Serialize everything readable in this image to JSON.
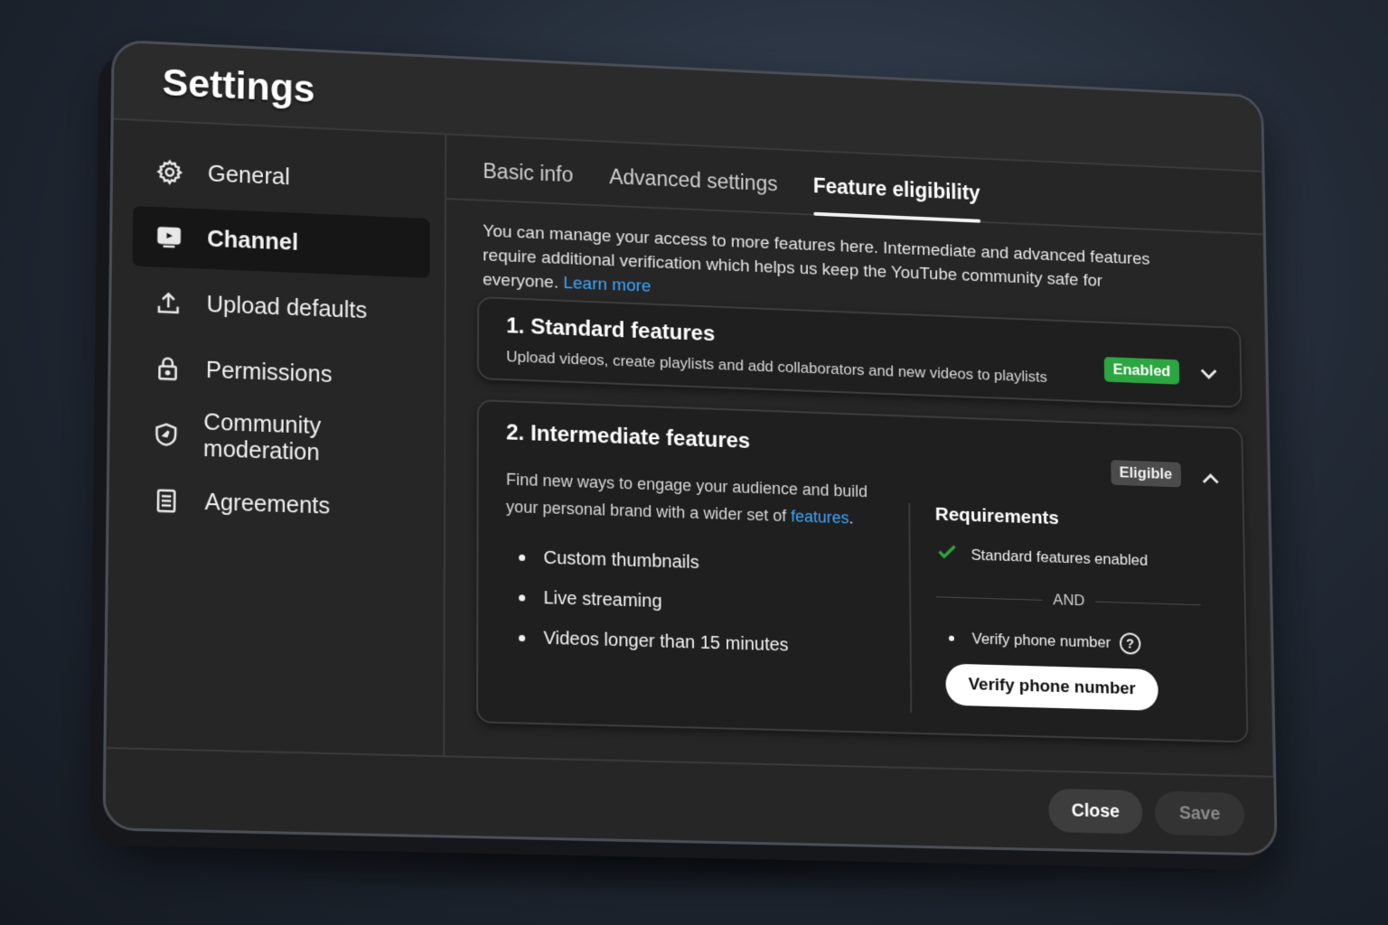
{
  "dialog": {
    "title": "Settings"
  },
  "sidebar": {
    "items": [
      {
        "label": "General",
        "icon": "gear-icon"
      },
      {
        "label": "Channel",
        "icon": "channel-icon",
        "active": true
      },
      {
        "label": "Upload defaults",
        "icon": "upload-icon"
      },
      {
        "label": "Permissions",
        "icon": "lock-icon"
      },
      {
        "label": "Community moderation",
        "icon": "shield-icon"
      },
      {
        "label": "Agreements",
        "icon": "document-icon"
      }
    ]
  },
  "tabs": [
    {
      "label": "Basic info"
    },
    {
      "label": "Advanced settings"
    },
    {
      "label": "Feature eligibility",
      "active": true
    }
  ],
  "intro": {
    "text": "You can manage your access to more features here. Intermediate and advanced features require additional verification which helps us keep the YouTube community safe for everyone.",
    "link": "Learn more"
  },
  "standard": {
    "title": "1. Standard features",
    "description": "Upload videos, create playlists and add collaborators and new videos to playlists",
    "badge": "Enabled"
  },
  "intermediate": {
    "title": "2. Intermediate features",
    "description": "Find new ways to engage your audience and build your personal brand with a wider set of",
    "description_link": "features",
    "description_end": ".",
    "badge": "Eligible",
    "features": [
      "Custom thumbnails",
      "Live streaming",
      "Videos longer than 15 minutes"
    ],
    "requirements": {
      "title": "Requirements",
      "met": "Standard features enabled",
      "and": "AND",
      "pending": "Verify phone number",
      "button": "Verify phone number"
    }
  },
  "footer": {
    "close": "Close",
    "save": "Save"
  },
  "colors": {
    "accent_link": "#3ea6ff",
    "enabled_green": "#2ba640",
    "background": "#262626"
  }
}
